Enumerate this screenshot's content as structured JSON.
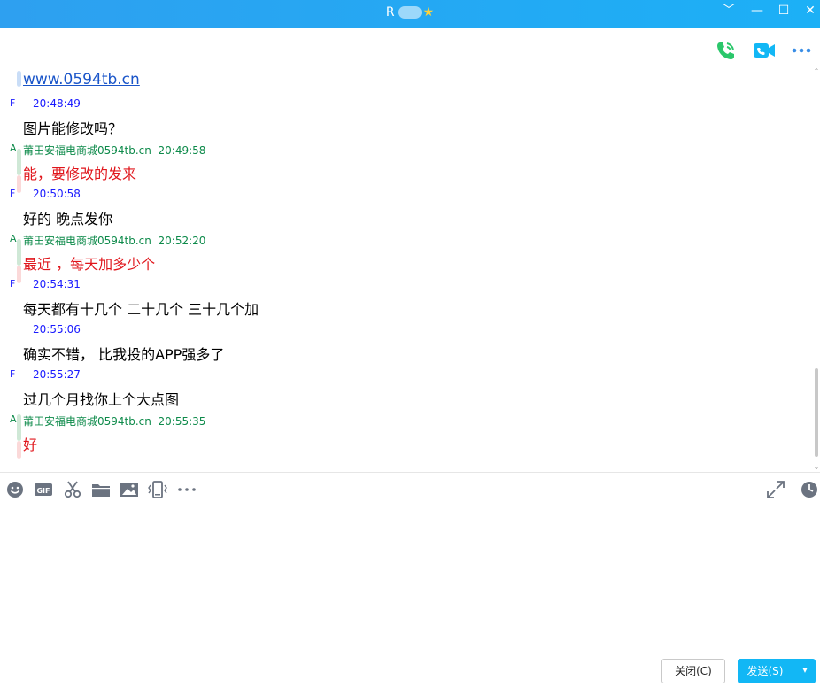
{
  "window": {
    "title": "R",
    "controls": {
      "menu": "﹀",
      "minimize": "—",
      "maximize": "☐",
      "close": "✕"
    }
  },
  "header_icons": [
    "phone-icon",
    "video-call-icon",
    "more-icon"
  ],
  "chat": {
    "link": "www.0594tb.cn",
    "messages": [
      {
        "sender": "F",
        "sender_type": "me",
        "name": "",
        "time": "20:48:49",
        "text": "图片能修改吗？"
      },
      {
        "sender": "A",
        "sender_type": "other",
        "name": "莆田安福电商城0594tb.cn",
        "time": "20:49:58",
        "text": "能，要修改的发来"
      },
      {
        "sender": "F",
        "sender_type": "me",
        "name": "",
        "time": "20:50:58",
        "text": "好的  晚点发你"
      },
      {
        "sender": "A",
        "sender_type": "other",
        "name": "莆田安福电商城0594tb.cn",
        "time": "20:52:20",
        "text": "最近 ，每天加多少个"
      },
      {
        "sender": "F",
        "sender_type": "me",
        "name": "",
        "time": "20:54:31",
        "text": "每天都有十几个  二十几个 三十几个加"
      },
      {
        "sender": "F",
        "sender_type": "me",
        "name": "",
        "time": "20:55:06",
        "text": "确实不错， 比我投的APP强多了"
      },
      {
        "sender": "F",
        "sender_type": "me",
        "name": "",
        "time": "20:55:27",
        "text": "过几个月找你上个大点图"
      },
      {
        "sender": "A",
        "sender_type": "other",
        "name": "莆田安福电商城0594tb.cn",
        "time": "20:55:35",
        "text": "好"
      }
    ]
  },
  "toolbar": {
    "icons": [
      "emoji-icon",
      "gif-icon",
      "scissors-icon",
      "folder-icon",
      "image-icon",
      "shake-icon",
      "more-tools-icon"
    ],
    "gif_label": "GIF",
    "right_icons": [
      "expand-icon",
      "history-icon"
    ]
  },
  "buttons": {
    "close_label": "关闭(C)",
    "send_label": "发送(S)",
    "send_dropdown": "▾"
  },
  "colors": {
    "title_bar": "#1cb0f6",
    "me_meta": "#1a1aff",
    "other_meta": "#0d8a4a",
    "other_text": "#e0151b",
    "send_button": "#12b7f5"
  }
}
